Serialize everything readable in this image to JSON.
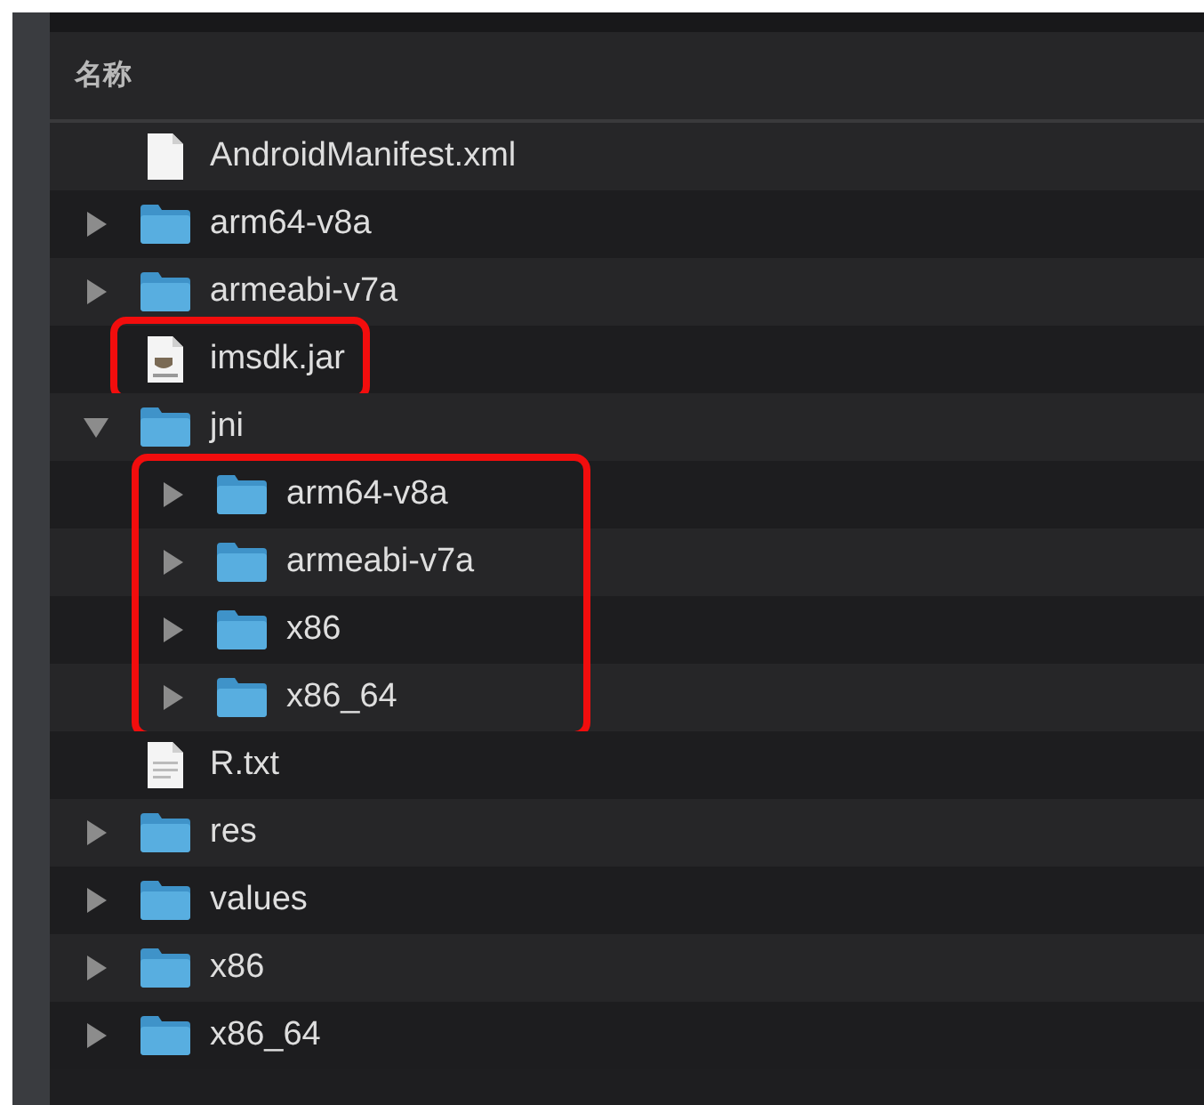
{
  "header": {
    "column": "名称"
  },
  "items": [
    {
      "name": "AndroidManifest.xml",
      "kind": "document",
      "highlighted": false
    },
    {
      "name": "arm64-v8a",
      "kind": "folder",
      "expanded": false,
      "highlighted": false
    },
    {
      "name": "armeabi-v7a",
      "kind": "folder",
      "expanded": false,
      "highlighted": false
    },
    {
      "name": "imsdk.jar",
      "kind": "jar",
      "highlighted": true
    },
    {
      "name": "jni",
      "kind": "folder",
      "expanded": true,
      "highlighted": false,
      "children_highlighted": true,
      "children": [
        {
          "name": "arm64-v8a",
          "kind": "folder",
          "expanded": false,
          "highlighted": false
        },
        {
          "name": "armeabi-v7a",
          "kind": "folder",
          "expanded": false,
          "highlighted": false
        },
        {
          "name": "x86",
          "kind": "folder",
          "expanded": false,
          "highlighted": false
        },
        {
          "name": "x86_64",
          "kind": "folder",
          "expanded": false,
          "highlighted": false
        }
      ]
    },
    {
      "name": "R.txt",
      "kind": "text",
      "highlighted": false
    },
    {
      "name": "res",
      "kind": "folder",
      "expanded": false,
      "highlighted": false
    },
    {
      "name": "values",
      "kind": "folder",
      "expanded": false,
      "highlighted": false
    },
    {
      "name": "x86",
      "kind": "folder",
      "expanded": false,
      "highlighted": false
    },
    {
      "name": "x86_64",
      "kind": "folder",
      "expanded": false,
      "highlighted": false
    }
  ]
}
